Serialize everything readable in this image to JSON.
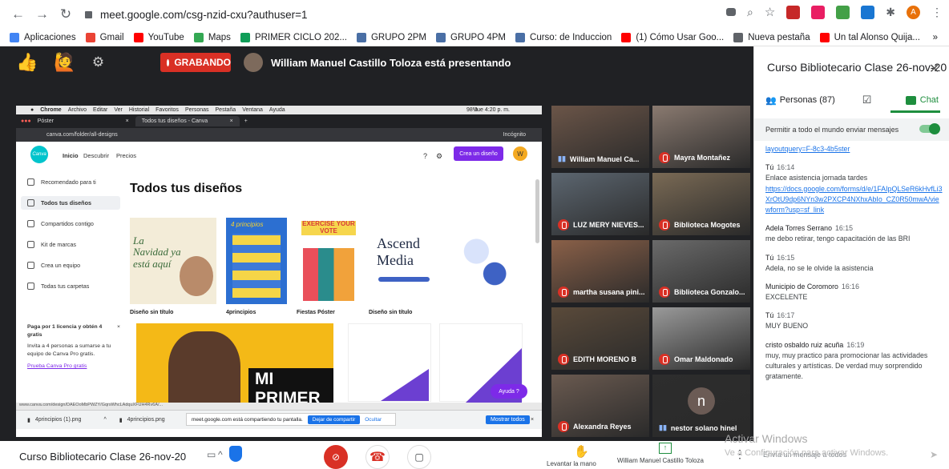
{
  "browser": {
    "url": "meet.google.com/csg-nzid-cxu?authuser=1",
    "avatar_letter": "A"
  },
  "bookmarks": [
    {
      "label": "Aplicaciones",
      "color": "#4285f4"
    },
    {
      "label": "Gmail",
      "color": "#ea4335"
    },
    {
      "label": "YouTube",
      "color": "#ff0000"
    },
    {
      "label": "Maps",
      "color": "#34a853"
    },
    {
      "label": "PRIMER CICLO 202...",
      "color": "#0f9d58"
    },
    {
      "label": "GRUPO 2PM",
      "color": "#4a6fa5"
    },
    {
      "label": "GRUPO 4PM",
      "color": "#4a6fa5"
    },
    {
      "label": "Curso: de Induccion",
      "color": "#4a6fa5"
    },
    {
      "label": "(1) Cómo Usar Goo...",
      "color": "#ff0000"
    },
    {
      "label": "Nueva pestaña",
      "color": "#5f6368"
    },
    {
      "label": "Un tal Alonso Quija...",
      "color": "#ff0000"
    }
  ],
  "bookmarks_more": "»",
  "meet": {
    "recording_label": "GRABANDO",
    "presenter_text": "William Manuel Castillo Toloza está presentando"
  },
  "shared_screen": {
    "mac_menu": [
      "Chrome",
      "Archivo",
      "Editar",
      "Ver",
      "Historial",
      "Favoritos",
      "Personas",
      "Pestaña",
      "Ventana",
      "Ayuda"
    ],
    "mac_clock": "Jue 4:20 p. m.",
    "mac_battery": "98%",
    "tabs": [
      "Póster",
      "Todos tus diseños - Canva"
    ],
    "address": "canva.com/folder/all-designs",
    "incognito": "Incógnito",
    "canva": {
      "logo": "Canva",
      "nav": [
        "Inicio",
        "Descubrir",
        "Precios"
      ],
      "create_button": "Crea un diseño",
      "user_initial": "W",
      "sidebar": [
        "Recomendado para ti",
        "Todos tus diseños",
        "Compartidos contigo",
        "Kit de marcas",
        "Crea un equipo",
        "Todas tus carpetas"
      ],
      "page_title": "Todos tus diseños",
      "promo_title": "Paga por 1 licencia y obtén 4 gratis",
      "promo_text": "Invita a 4 personas a sumarse a tu equipo de Canva Pro gratis.",
      "promo_link": "Prueba Canva Pro gratis",
      "designs": [
        "Diseño sin título",
        "4principios",
        "Fiestas Póster",
        "Diseño sin título"
      ],
      "card1_text": "La Navidad ya está aquí",
      "card2_text": "4 principios",
      "card3_text": "EXERCISE YOUR VOTE",
      "card4_text": "Ascend Media",
      "banner_text": "MI PRIMER",
      "help_button": "Ayuda ?"
    },
    "status_url": "www.canva.com/design/DAEOoMbPWZY/GqrsWhcLAdquXFUH4Rv6A/...",
    "sharing_msg": "meet.google.com está compartiendo tu pantalla.",
    "stop_share": "Dejar de compartir",
    "hide": "Ocultar",
    "downloads": [
      "4principios (1).png",
      "4principios.png"
    ],
    "show_all": "Mostrar todos"
  },
  "participants": [
    {
      "name": "William Manuel Ca...",
      "muted": false,
      "color": "#6b5548"
    },
    {
      "name": "Mayra Montañez",
      "muted": true,
      "color": "#8a7a70"
    },
    {
      "name": "LUZ MERY NIEVES...",
      "muted": true,
      "color": "#5c6670"
    },
    {
      "name": "Biblioteca Mogotes",
      "muted": true,
      "color": "#7a6a55"
    },
    {
      "name": "martha susana pini...",
      "muted": true,
      "color": "#8a6048"
    },
    {
      "name": "Biblioteca Gonzalo...",
      "muted": true,
      "color": "#6a6a6a"
    },
    {
      "name": "EDITH MORENO B",
      "muted": true,
      "color": "#5a4a3a"
    },
    {
      "name": "Omar Maldonado",
      "muted": true,
      "color": "#9a9a9a"
    },
    {
      "name": "Alexandra Reyes",
      "muted": true,
      "color": "#6a5a50"
    },
    {
      "name": "nestor solano hinel",
      "muted": false,
      "color": "#2d2d2d",
      "initial": "n"
    }
  ],
  "bottom": {
    "meeting_title": "Curso Bibliotecario Clase 26-nov-20",
    "raise_hand": "Levantar la mano",
    "presenting": "William Manuel Castillo Toloza"
  },
  "sidebar": {
    "title": "Curso Bibliotecario Clase 26-nov-20",
    "people_tab": "Personas (87)",
    "chat_tab": "Chat",
    "allow_msgs": "Permitir a todo el mundo enviar mensajes",
    "input_placeholder": "Envía un mensaje a todos",
    "messages": [
      {
        "who": "",
        "time": "",
        "text": "",
        "link": "layoutquery=F-8c3-4b5ster"
      },
      {
        "who": "Tú",
        "time": "16:14",
        "text": "Enlace asistencia jornada tardes",
        "link": "https://docs.google.com/forms/d/e/1FAIpQLSeR6kHvfLi3XrOtU9dp6NYn3w2PXCP4NXhxAbIo_CZ0R50mwA/viewform?usp=sf_link"
      },
      {
        "who": "Adela Torres Serrano",
        "time": "16:15",
        "text": "me debo retirar, tengo capacitación de las BRI",
        "link": ""
      },
      {
        "who": "Tú",
        "time": "16:15",
        "text": "Adela, no se le olvide la asistencia",
        "link": ""
      },
      {
        "who": "Municipio de Coromoro",
        "time": "16:16",
        "text": "EXCELENTE",
        "link": ""
      },
      {
        "who": "Tú",
        "time": "16:17",
        "text": "MUY BUENO",
        "link": ""
      },
      {
        "who": "cristo osbaldo ruiz acuña",
        "time": "16:19",
        "text": "muy, muy practico para promocionar las actividades culturales y artísticas. De verdad muy sorprendido gratamente.",
        "link": ""
      }
    ]
  },
  "watermark": {
    "title": "Activar Windows",
    "subtitle": "Ve a Configuración para activar Windows."
  }
}
